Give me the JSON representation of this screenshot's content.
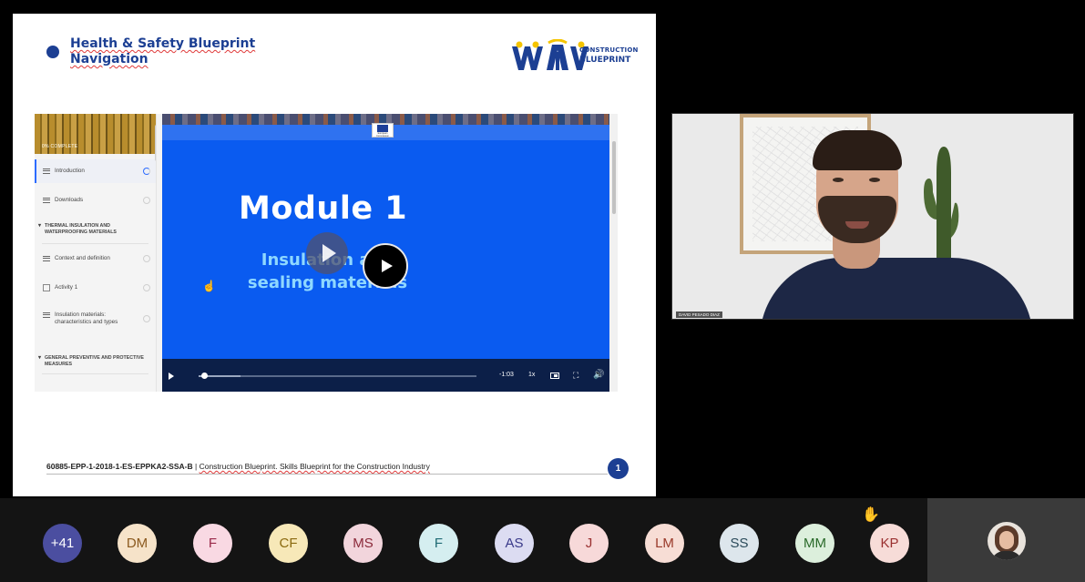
{
  "slide": {
    "title_line1": "Health & Safety Blueprint",
    "title_line2": "Navigation",
    "logo_line1": "CONSTRUCTION",
    "logo_line2": "BLUEPRINT",
    "footer_code": "60885-EPP-1-2018-1-ES-EPPKA2-SSA-B",
    "footer_separator": "|",
    "footer_text": "Construction Blueprint. Skills Blueprint for the Construction Industry",
    "page_number": "1"
  },
  "course": {
    "sidebar_header": "0% COMPLETE",
    "items": [
      {
        "label": "Introduction"
      },
      {
        "label": "Downloads"
      },
      {
        "label": "THERMAL INSULATION AND WATERPROOFING MATERIALS"
      },
      {
        "label": "Context and definition"
      },
      {
        "label": "Activity 1"
      },
      {
        "label": "Insulation materials: characteristics and types"
      },
      {
        "label": "GENERAL PREVENTIVE AND PROTECTIVE MEASURES"
      }
    ],
    "video": {
      "title": "Module 1",
      "subtitle_line1": "Insulation and",
      "subtitle_line2": "sealing materials",
      "eu_badge_text": "European Commission",
      "time_remaining": "-1:03",
      "speed": "1x",
      "progress": 0.02,
      "buffered": 0.15
    }
  },
  "presenter": {
    "name": "DAVID PESADO DIAZ"
  },
  "participants": [
    {
      "initials": "+41",
      "bg": "#4b4ea0",
      "fg": "#ffffff"
    },
    {
      "initials": "DM",
      "bg": "#f6e3c9",
      "fg": "#8b5a1f"
    },
    {
      "initials": "F",
      "bg": "#f9d9e3",
      "fg": "#9a2a4a"
    },
    {
      "initials": "CF",
      "bg": "#f7e8b8",
      "fg": "#8b6a10"
    },
    {
      "initials": "MS",
      "bg": "#f2d5dc",
      "fg": "#8b2a3a"
    },
    {
      "initials": "F",
      "bg": "#d5eef0",
      "fg": "#1f6a74"
    },
    {
      "initials": "AS",
      "bg": "#dcdcf2",
      "fg": "#3a3a8a"
    },
    {
      "initials": "J",
      "bg": "#f7d9d9",
      "fg": "#9a3030"
    },
    {
      "initials": "LM",
      "bg": "#f7ddd5",
      "fg": "#9a3a2a"
    },
    {
      "initials": "SS",
      "bg": "#dde6ec",
      "fg": "#2a4a5a"
    },
    {
      "initials": "MM",
      "bg": "#dcefdc",
      "fg": "#2a6a2a"
    },
    {
      "initials": "KP",
      "bg": "#f7dcd8",
      "fg": "#9a3030"
    }
  ],
  "icons": {
    "raised_hand": "raised-hand-icon",
    "play": "play-icon",
    "fullscreen": "fullscreen-icon",
    "volume": "volume-icon"
  }
}
